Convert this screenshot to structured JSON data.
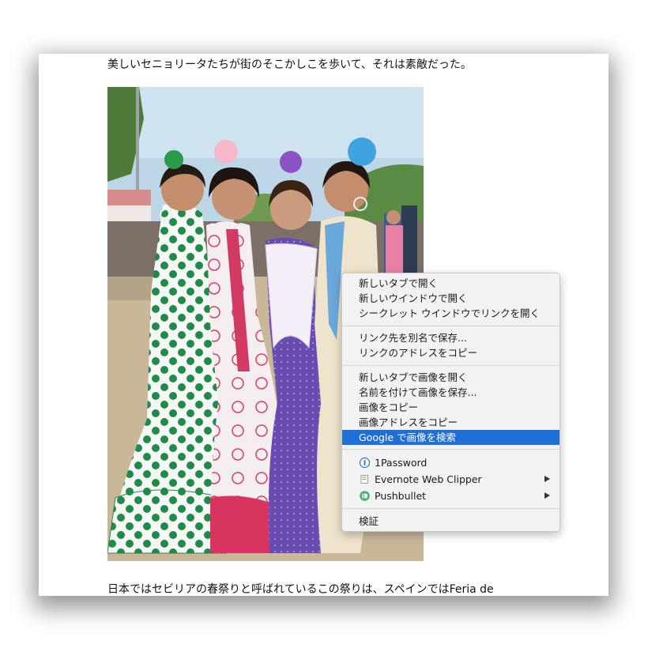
{
  "article": {
    "caption": "美しいセニョリータたちが街のそこかしこを歩いて、それは素敵だった。",
    "body_line": "日本ではセビリアの春祭りと呼ばれているこの祭りは、スペインではFeria de"
  },
  "context_menu": {
    "groups": [
      {
        "items": [
          {
            "label": "新しいタブで開く"
          },
          {
            "label": "新しいウインドウで開く"
          },
          {
            "label": "シークレット ウインドウでリンクを開く"
          }
        ]
      },
      {
        "items": [
          {
            "label": "リンク先を別名で保存..."
          },
          {
            "label": "リンクのアドレスをコピー"
          }
        ]
      },
      {
        "items": [
          {
            "label": "新しいタブで画像を開く"
          },
          {
            "label": "名前を付けて画像を保存..."
          },
          {
            "label": "画像をコピー"
          },
          {
            "label": "画像アドレスをコピー"
          },
          {
            "label": "Google で画像を検索",
            "highlighted": true
          }
        ]
      },
      {
        "items": [
          {
            "label": "1Password",
            "icon": "1password-icon"
          },
          {
            "label": "Evernote Web Clipper",
            "icon": "evernote-clipper-icon",
            "submenu": true
          },
          {
            "label": "Pushbullet",
            "icon": "pushbullet-icon",
            "submenu": true
          }
        ]
      },
      {
        "items": [
          {
            "label": "検証"
          }
        ]
      }
    ]
  },
  "colors": {
    "menu_highlight": "#1f6fd6",
    "menu_background": "#f2f2f2"
  }
}
